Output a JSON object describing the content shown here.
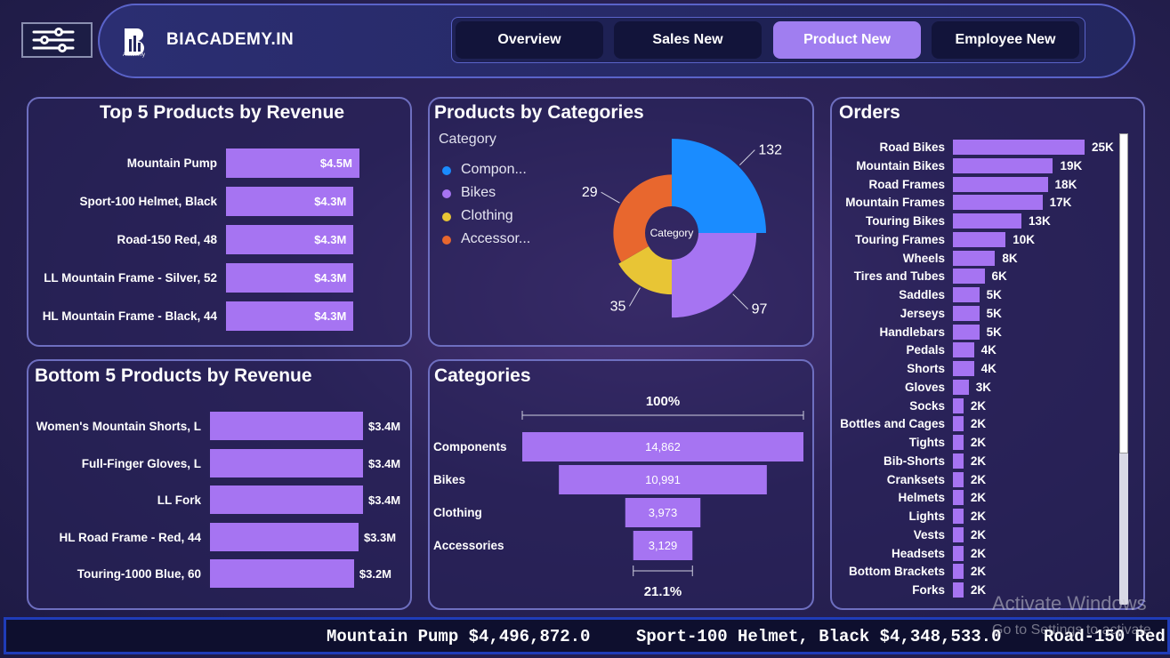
{
  "header": {
    "brand": "BIACADEMY.IN",
    "logo_sub": "Academy",
    "nav": [
      "Overview",
      "Sales New",
      "Product New",
      "Employee New"
    ],
    "active_nav": "Product New"
  },
  "top5": {
    "title": "Top 5 Products by Revenue",
    "chart_data": {
      "type": "bar",
      "categories": [
        "Mountain Pump",
        "Sport-100 Helmet, Black",
        "Road-150 Red, 48",
        "LL Mountain Frame - Silver, 52",
        "HL Mountain Frame - Black, 44"
      ],
      "values": [
        4.5,
        4.3,
        4.3,
        4.3,
        4.3
      ],
      "labels": [
        "$4.5M",
        "$4.3M",
        "$4.3M",
        "$4.3M",
        "$4.3M"
      ],
      "title": "Top 5 Products by Revenue"
    }
  },
  "bottom5": {
    "title": "Bottom 5 Products by Revenue",
    "chart_data": {
      "type": "bar",
      "categories": [
        "Women's Mountain Shorts, L",
        "Full-Finger Gloves, L",
        "LL Fork",
        "HL Road Frame - Red, 44",
        "Touring-1000 Blue, 60"
      ],
      "values": [
        3.4,
        3.4,
        3.4,
        3.3,
        3.2
      ],
      "labels": [
        "$3.4M",
        "$3.4M",
        "$3.4M",
        "$3.3M",
        "$3.2M"
      ],
      "title": "Bottom 5 Products by Revenue"
    }
  },
  "by_categories": {
    "title": "Products by Categories",
    "legend_title": "Category",
    "center_label": "Category",
    "chart_data": {
      "type": "pie",
      "categories": [
        "Compon...",
        "Bikes",
        "Clothing",
        "Accessor..."
      ],
      "values": [
        132,
        97,
        35,
        29
      ],
      "colors": [
        "#1a8cff",
        "#a674f2",
        "#e8c535",
        "#e8672e"
      ],
      "title": "Products by Categories"
    }
  },
  "funnel": {
    "title": "Categories",
    "top_pct": "100%",
    "bottom_pct": "21.1%",
    "chart_data": {
      "type": "bar",
      "categories": [
        "Components",
        "Bikes",
        "Clothing",
        "Accessories"
      ],
      "values": [
        14862,
        10991,
        3973,
        3129
      ],
      "labels": [
        "14,862",
        "10,991",
        "3,973",
        "3,129"
      ],
      "title": "Categories"
    }
  },
  "orders": {
    "title": "Orders",
    "chart_data": {
      "type": "bar",
      "categories": [
        "Road Bikes",
        "Mountain Bikes",
        "Road Frames",
        "Mountain Frames",
        "Touring Bikes",
        "Touring Frames",
        "Wheels",
        "Tires and Tubes",
        "Saddles",
        "Jerseys",
        "Handlebars",
        "Pedals",
        "Shorts",
        "Gloves",
        "Socks",
        "Bottles and Cages",
        "Tights",
        "Bib-Shorts",
        "Cranksets",
        "Helmets",
        "Lights",
        "Vests",
        "Headsets",
        "Bottom Brackets",
        "Forks"
      ],
      "values": [
        25,
        19,
        18,
        17,
        13,
        10,
        8,
        6,
        5,
        5,
        5,
        4,
        4,
        3,
        2,
        2,
        2,
        2,
        2,
        2,
        2,
        2,
        2,
        2,
        2
      ],
      "labels": [
        "25K",
        "19K",
        "18K",
        "17K",
        "13K",
        "10K",
        "8K",
        "6K",
        "5K",
        "5K",
        "5K",
        "4K",
        "4K",
        "3K",
        "2K",
        "2K",
        "2K",
        "2K",
        "2K",
        "2K",
        "2K",
        "2K",
        "2K",
        "2K",
        "2K"
      ],
      "title": "Orders"
    }
  },
  "ticker": {
    "items": [
      "Mountain Pump $4,496,872.0",
      "Sport-100 Helmet, Black $4,348,533.0",
      "Road-150 Red,"
    ]
  },
  "watermark": {
    "line1": "Activate Windows",
    "line2": "Go to Settings to activate"
  }
}
